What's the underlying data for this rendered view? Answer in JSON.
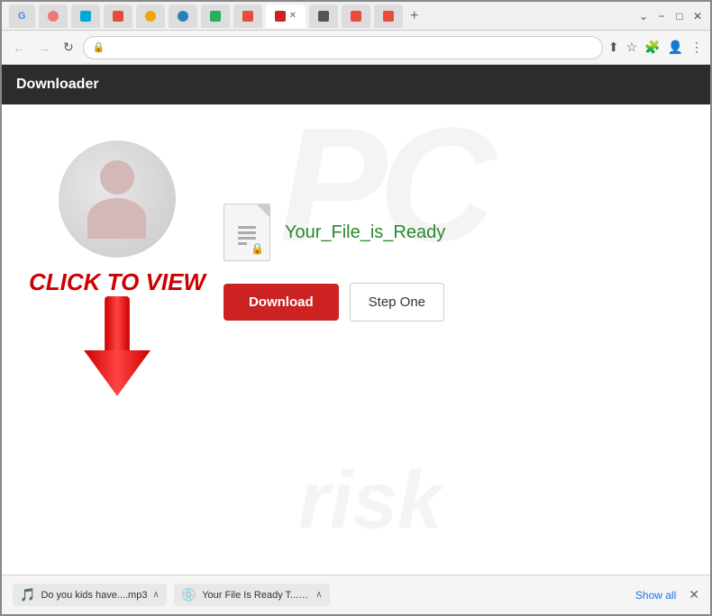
{
  "browser": {
    "tabs": [
      {
        "label": "G",
        "favicon": "G",
        "active": false
      },
      {
        "label": "⊙",
        "favicon": "",
        "active": false
      },
      {
        "label": "b",
        "favicon": "",
        "active": false
      },
      {
        "label": "◈",
        "favicon": "",
        "active": false
      },
      {
        "label": "⚠",
        "favicon": "",
        "active": false
      },
      {
        "label": "◎",
        "favicon": "",
        "active": false
      },
      {
        "label": "▷",
        "favicon": "",
        "active": false
      },
      {
        "label": "▶",
        "favicon": "",
        "active": false
      },
      {
        "label": "",
        "favicon": "",
        "active": true
      },
      {
        "label": "■",
        "favicon": "",
        "active": false
      },
      {
        "label": "🎞",
        "favicon": "",
        "active": false
      },
      {
        "label": "▶",
        "favicon": "",
        "active": false
      }
    ],
    "add_tab_label": "+",
    "title_controls": {
      "minimize": "−",
      "maximize": "□",
      "close": "✕"
    },
    "nav": {
      "back": "←",
      "forward": "→",
      "refresh": "↻"
    },
    "address": {
      "lock_icon": "🔒",
      "url": ""
    },
    "toolbar_icons": {
      "share": "⬆",
      "bookmark": "☆",
      "extensions": "🧩",
      "profile": "👤",
      "menu": "⋮"
    }
  },
  "app_header": {
    "title": "Downloader"
  },
  "main": {
    "click_to_view": "CLICK TO VIEW",
    "file_name": "Your_File_is_Ready",
    "download_button": "Download",
    "step_one_button": "Step One"
  },
  "download_bar": {
    "item1": {
      "icon": "🎵",
      "name": "Do you kids have....mp3"
    },
    "item2": {
      "icon": "💿",
      "name": "Your File Is Ready T....iso"
    },
    "show_all": "Show all",
    "close": "✕"
  }
}
